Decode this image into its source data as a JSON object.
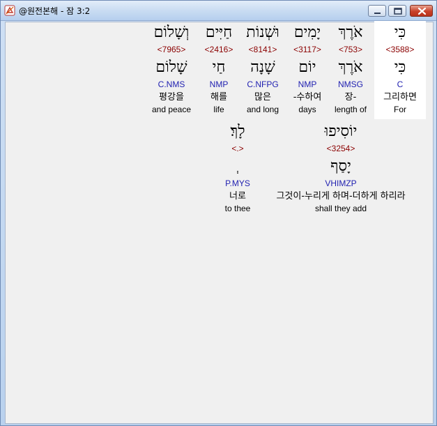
{
  "window": {
    "title": "@원전본해 - 잠 3:2",
    "icon": "scroll-app-icon",
    "controls": [
      "minimize-icon",
      "maximize-icon",
      "close-icon"
    ]
  },
  "colors": {
    "strong_number": "#8b0000",
    "parsing": "#1f1fb0",
    "selected_background": "#ffffff"
  },
  "words": [
    {
      "hebrew": "כִּי",
      "strong": "<3588>",
      "root": "כִּי",
      "parsing": "C",
      "korean": "그리하면",
      "english": "For"
    },
    {
      "hebrew": "אֹרֶךְ",
      "strong": "<753>",
      "root": "אֹרֶךְ",
      "parsing": "NMSG",
      "korean": "장-",
      "english": "length of"
    },
    {
      "hebrew": "יָמִים",
      "strong": "<3117>",
      "root": "יוֹם",
      "parsing": "NMP",
      "korean": "-수하여",
      "english": "days"
    },
    {
      "hebrew": "וּשְׁנוֹת",
      "strong": "<8141>",
      "root": "שָׁנָה",
      "parsing": "C.NFPG",
      "korean": "많은",
      "english": "and long"
    },
    {
      "hebrew": "חַיִּים",
      "strong": "<2416>",
      "root": "חַי",
      "parsing": "NMP",
      "korean": "해를",
      "english": "life"
    },
    {
      "hebrew": "וְשָׁלוֹם",
      "strong": "<7965>",
      "root": "שָׁלוֹם",
      "parsing": "C.NMS",
      "korean": "평강을",
      "english": "and peace"
    },
    {
      "hebrew": "יוֹסִיפוּ",
      "strong": "<3254>",
      "root": "יָסַף",
      "parsing": "VHIMZP",
      "korean": "그것이-누리게 하며-더하게 하리라",
      "english": "shall they add"
    },
    {
      "hebrew": "לָךְ׃",
      "strong": "<.>",
      "root": "ְ",
      "parsing": "P.MYS",
      "korean": "너로",
      "english": "to thee"
    }
  ]
}
